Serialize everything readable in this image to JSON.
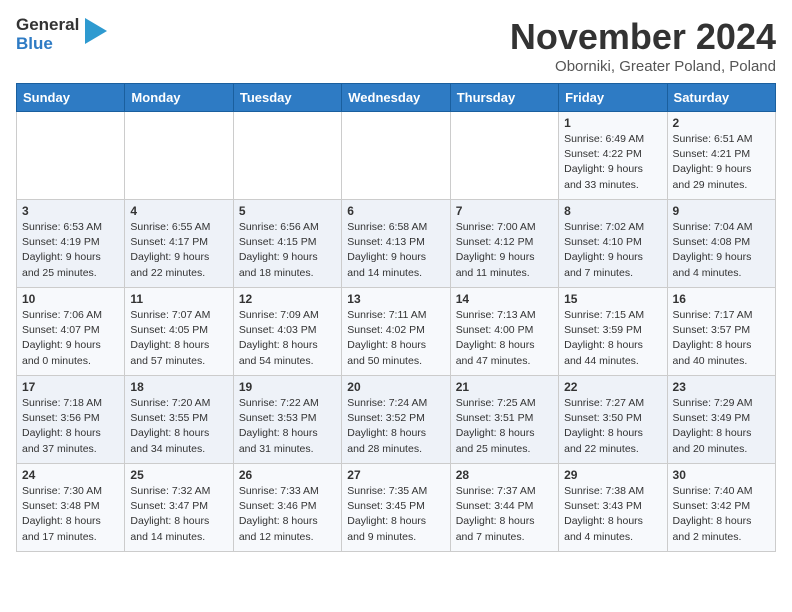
{
  "header": {
    "logo_line1": "General",
    "logo_line2": "Blue",
    "title": "November 2024",
    "location": "Oborniki, Greater Poland, Poland"
  },
  "days_of_week": [
    "Sunday",
    "Monday",
    "Tuesday",
    "Wednesday",
    "Thursday",
    "Friday",
    "Saturday"
  ],
  "weeks": [
    [
      {
        "day": "",
        "info": ""
      },
      {
        "day": "",
        "info": ""
      },
      {
        "day": "",
        "info": ""
      },
      {
        "day": "",
        "info": ""
      },
      {
        "day": "",
        "info": ""
      },
      {
        "day": "1",
        "info": "Sunrise: 6:49 AM\nSunset: 4:22 PM\nDaylight: 9 hours and 33 minutes."
      },
      {
        "day": "2",
        "info": "Sunrise: 6:51 AM\nSunset: 4:21 PM\nDaylight: 9 hours and 29 minutes."
      }
    ],
    [
      {
        "day": "3",
        "info": "Sunrise: 6:53 AM\nSunset: 4:19 PM\nDaylight: 9 hours and 25 minutes."
      },
      {
        "day": "4",
        "info": "Sunrise: 6:55 AM\nSunset: 4:17 PM\nDaylight: 9 hours and 22 minutes."
      },
      {
        "day": "5",
        "info": "Sunrise: 6:56 AM\nSunset: 4:15 PM\nDaylight: 9 hours and 18 minutes."
      },
      {
        "day": "6",
        "info": "Sunrise: 6:58 AM\nSunset: 4:13 PM\nDaylight: 9 hours and 14 minutes."
      },
      {
        "day": "7",
        "info": "Sunrise: 7:00 AM\nSunset: 4:12 PM\nDaylight: 9 hours and 11 minutes."
      },
      {
        "day": "8",
        "info": "Sunrise: 7:02 AM\nSunset: 4:10 PM\nDaylight: 9 hours and 7 minutes."
      },
      {
        "day": "9",
        "info": "Sunrise: 7:04 AM\nSunset: 4:08 PM\nDaylight: 9 hours and 4 minutes."
      }
    ],
    [
      {
        "day": "10",
        "info": "Sunrise: 7:06 AM\nSunset: 4:07 PM\nDaylight: 9 hours and 0 minutes."
      },
      {
        "day": "11",
        "info": "Sunrise: 7:07 AM\nSunset: 4:05 PM\nDaylight: 8 hours and 57 minutes."
      },
      {
        "day": "12",
        "info": "Sunrise: 7:09 AM\nSunset: 4:03 PM\nDaylight: 8 hours and 54 minutes."
      },
      {
        "day": "13",
        "info": "Sunrise: 7:11 AM\nSunset: 4:02 PM\nDaylight: 8 hours and 50 minutes."
      },
      {
        "day": "14",
        "info": "Sunrise: 7:13 AM\nSunset: 4:00 PM\nDaylight: 8 hours and 47 minutes."
      },
      {
        "day": "15",
        "info": "Sunrise: 7:15 AM\nSunset: 3:59 PM\nDaylight: 8 hours and 44 minutes."
      },
      {
        "day": "16",
        "info": "Sunrise: 7:17 AM\nSunset: 3:57 PM\nDaylight: 8 hours and 40 minutes."
      }
    ],
    [
      {
        "day": "17",
        "info": "Sunrise: 7:18 AM\nSunset: 3:56 PM\nDaylight: 8 hours and 37 minutes."
      },
      {
        "day": "18",
        "info": "Sunrise: 7:20 AM\nSunset: 3:55 PM\nDaylight: 8 hours and 34 minutes."
      },
      {
        "day": "19",
        "info": "Sunrise: 7:22 AM\nSunset: 3:53 PM\nDaylight: 8 hours and 31 minutes."
      },
      {
        "day": "20",
        "info": "Sunrise: 7:24 AM\nSunset: 3:52 PM\nDaylight: 8 hours and 28 minutes."
      },
      {
        "day": "21",
        "info": "Sunrise: 7:25 AM\nSunset: 3:51 PM\nDaylight: 8 hours and 25 minutes."
      },
      {
        "day": "22",
        "info": "Sunrise: 7:27 AM\nSunset: 3:50 PM\nDaylight: 8 hours and 22 minutes."
      },
      {
        "day": "23",
        "info": "Sunrise: 7:29 AM\nSunset: 3:49 PM\nDaylight: 8 hours and 20 minutes."
      }
    ],
    [
      {
        "day": "24",
        "info": "Sunrise: 7:30 AM\nSunset: 3:48 PM\nDaylight: 8 hours and 17 minutes."
      },
      {
        "day": "25",
        "info": "Sunrise: 7:32 AM\nSunset: 3:47 PM\nDaylight: 8 hours and 14 minutes."
      },
      {
        "day": "26",
        "info": "Sunrise: 7:33 AM\nSunset: 3:46 PM\nDaylight: 8 hours and 12 minutes."
      },
      {
        "day": "27",
        "info": "Sunrise: 7:35 AM\nSunset: 3:45 PM\nDaylight: 8 hours and 9 minutes."
      },
      {
        "day": "28",
        "info": "Sunrise: 7:37 AM\nSunset: 3:44 PM\nDaylight: 8 hours and 7 minutes."
      },
      {
        "day": "29",
        "info": "Sunrise: 7:38 AM\nSunset: 3:43 PM\nDaylight: 8 hours and 4 minutes."
      },
      {
        "day": "30",
        "info": "Sunrise: 7:40 AM\nSunset: 3:42 PM\nDaylight: 8 hours and 2 minutes."
      }
    ]
  ]
}
